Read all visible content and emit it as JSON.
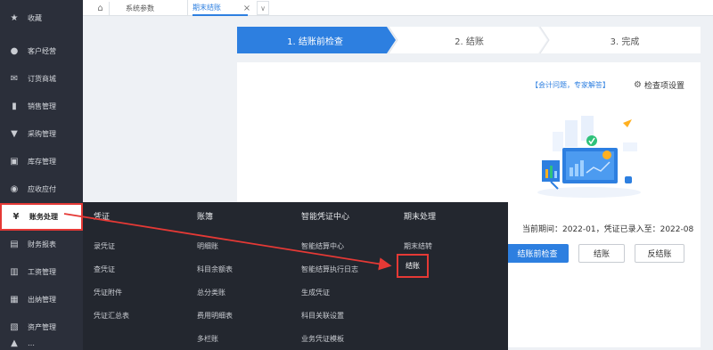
{
  "sidebar": {
    "items": [
      {
        "label": "收藏",
        "icon": "star-icon",
        "glyph": "★"
      },
      {
        "label": "客户经营",
        "icon": "user-icon",
        "glyph": "👤"
      },
      {
        "label": "订货商城",
        "icon": "mail-icon",
        "glyph": "✉"
      },
      {
        "label": "销售管理",
        "icon": "bar-chart-icon",
        "glyph": "▮"
      },
      {
        "label": "采购管理",
        "icon": "cart-icon",
        "glyph": "🛒"
      },
      {
        "label": "库存管理",
        "icon": "box-icon",
        "glyph": "▣"
      },
      {
        "label": "应收应付",
        "icon": "coin-icon",
        "glyph": "◉"
      },
      {
        "label": "账务处理",
        "icon": "ledger-icon",
        "glyph": "¥"
      },
      {
        "label": "财务报表",
        "icon": "report-icon",
        "glyph": "▤"
      },
      {
        "label": "工资管理",
        "icon": "wage-icon",
        "glyph": "▥"
      },
      {
        "label": "出纳管理",
        "icon": "cashier-icon",
        "glyph": "▦"
      },
      {
        "label": "资产管理",
        "icon": "asset-icon",
        "glyph": "▧"
      },
      {
        "label": "…",
        "icon": "more-icon",
        "glyph": "▲"
      }
    ]
  },
  "tabs": {
    "home_glyph": "⌂",
    "items": [
      "系统参数",
      "期末结账"
    ],
    "close_glyph": "×",
    "more_glyph": "∨"
  },
  "steps": [
    "1. 结账前检查",
    "2. 结账",
    "3. 完成"
  ],
  "panel": {
    "help_link": "【会计问题，专家解答】",
    "settings_label": "检查项设置",
    "period_text": "当前期间：2022-01，凭证已录入至：2022-08",
    "buttons": [
      "结账前检查",
      "结账",
      "反结账"
    ]
  },
  "menu": {
    "columns": [
      {
        "title": "凭证",
        "items": [
          "录凭证",
          "查凭证",
          "凭证附件",
          "凭证汇总表"
        ]
      },
      {
        "title": "账簿",
        "items": [
          "明细账",
          "科目余额表",
          "总分类账",
          "费用明细表",
          "多栏账"
        ]
      },
      {
        "title": "智能凭证中心",
        "items": [
          "智能结算中心",
          "智能结算执行日志",
          "生成凭证",
          "科目关联设置",
          "业务凭证模板"
        ]
      },
      {
        "title": "期末处理",
        "items": [
          "期末结转",
          "结账"
        ]
      }
    ]
  },
  "colors": {
    "accent": "#2d7fe0",
    "highlight": "#e53935",
    "sidebar_bg": "#2b2f3a",
    "dropdown_bg": "#23272f"
  }
}
